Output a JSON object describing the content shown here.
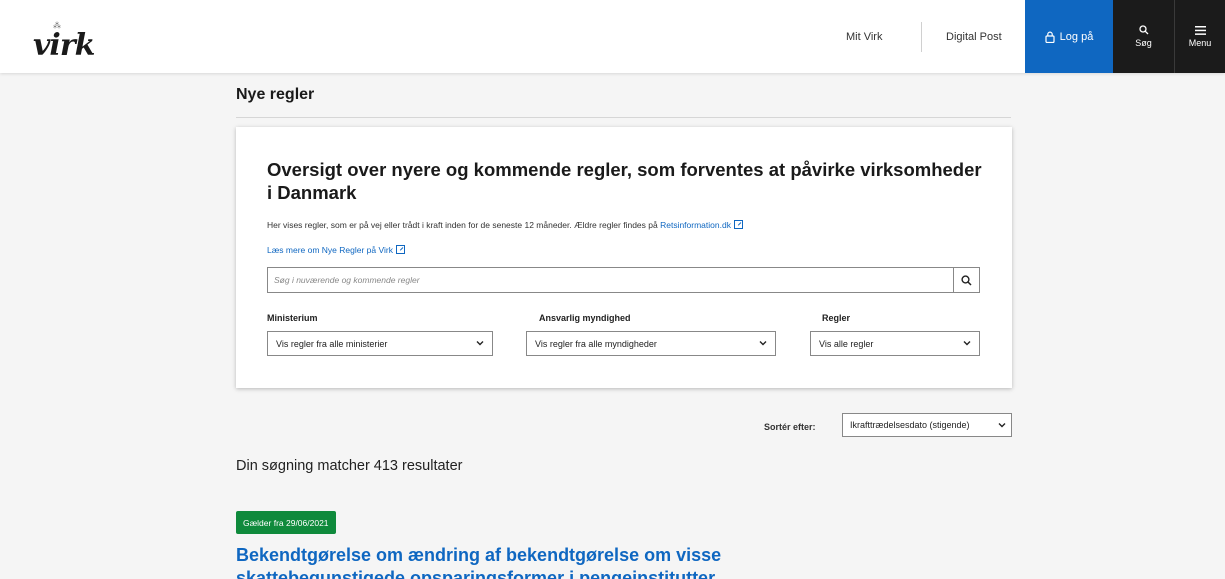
{
  "header": {
    "logo_text": "virk",
    "nav": {
      "mit_virk": "Mit Virk",
      "digital_post": "Digital Post"
    },
    "login_label": "Log på",
    "search_label": "Søg",
    "menu_label": "Menu"
  },
  "page": {
    "heading": "Nye regler"
  },
  "card": {
    "title": "Oversigt over nyere og kommende regler, som forventes at påvirke virksomheder i Danmark",
    "intro_text": "Her vises regler, som er på vej eller trådt i kraft inden for de seneste 12 måneder. Ældre regler findes på ",
    "intro_link": "Retsinformation.dk",
    "more_link": "Læs mere om Nye Regler på Virk",
    "search_placeholder": "Søg i nuværende og kommende regler",
    "filters": [
      {
        "label": "Ministerium",
        "value": "Vis regler fra alle ministerier"
      },
      {
        "label": "Ansvarlig myndighed",
        "value": "Vis regler fra alle myndigheder"
      },
      {
        "label": "Regler",
        "value": "Vis alle regler"
      }
    ]
  },
  "sort": {
    "label": "Sortér efter:",
    "value": "Ikrafttrædelsesdato (stigende)"
  },
  "results": {
    "count_text": "Din søgning matcher 413 resultater",
    "items": [
      {
        "badge": "Gælder fra 29/06/2021",
        "title": "Bekendtgørelse om ændring af bekendtgørelse om visse skattebegunstigede opsparingsformer i pengeinstitutter"
      }
    ]
  },
  "colors": {
    "primary": "#0f67c1",
    "dark": "#1b1b1b",
    "badge_green": "#0f8a3c"
  }
}
